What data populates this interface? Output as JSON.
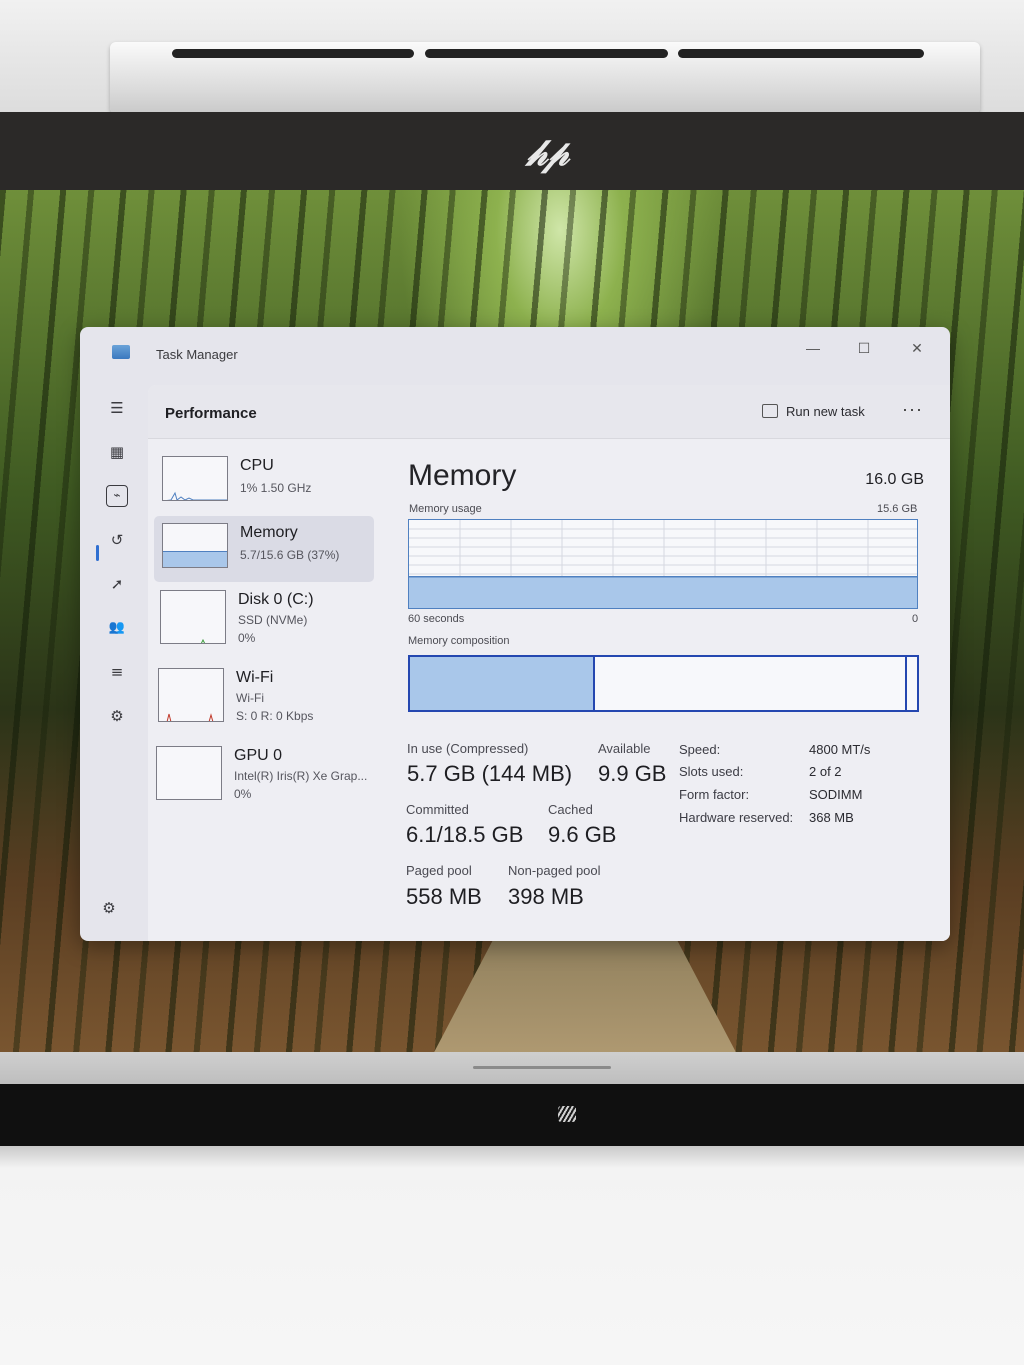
{
  "window": {
    "title": "Task Manager",
    "minimize_glyph": "—",
    "maximize_glyph": "☐",
    "close_glyph": "✕"
  },
  "nav": {
    "items": [
      {
        "name": "hamburger-menu-icon",
        "glyph": "☰"
      },
      {
        "name": "processes-icon",
        "glyph": "▦"
      },
      {
        "name": "performance-icon",
        "glyph": "⌁"
      },
      {
        "name": "app-history-icon",
        "glyph": "↺"
      },
      {
        "name": "startup-apps-icon",
        "glyph": "➚"
      },
      {
        "name": "users-icon",
        "glyph": "👥"
      },
      {
        "name": "details-icon",
        "glyph": "≡"
      },
      {
        "name": "services-icon",
        "glyph": "⚙"
      }
    ],
    "settings_glyph": "⚙"
  },
  "header": {
    "page_title": "Performance",
    "run_task_label": "Run new task",
    "more_glyph": "···"
  },
  "resources": [
    {
      "name": "CPU",
      "line1": "1%  1.50 GHz",
      "line2": ""
    },
    {
      "name": "Memory",
      "line1": "5.7/15.6 GB (37%)",
      "line2": ""
    },
    {
      "name": "Disk 0 (C:)",
      "line1": "SSD (NVMe)",
      "line2": "0%"
    },
    {
      "name": "Wi-Fi",
      "line1": "Wi-Fi",
      "line2": "S: 0  R: 0 Kbps"
    },
    {
      "name": "GPU 0",
      "line1": "Intel(R) Iris(R) Xe Grap...",
      "line2": "0%"
    }
  ],
  "detail": {
    "title": "Memory",
    "total": "16.0 GB",
    "usage_label": "Memory usage",
    "usage_max": "15.6 GB",
    "time_label": "60 seconds",
    "time_zero": "0",
    "composition_label": "Memory composition",
    "usage_fraction": 0.37,
    "composition": {
      "in_use_fraction": 0.365,
      "modified_fraction": 0.003,
      "standby_fraction": 0.612,
      "free_fraction": 0.02
    },
    "stats": {
      "in_use_label": "In use (Compressed)",
      "in_use_value": "5.7 GB (144 MB)",
      "available_label": "Available",
      "available_value": "9.9 GB",
      "committed_label": "Committed",
      "committed_value": "6.1/18.5 GB",
      "cached_label": "Cached",
      "cached_value": "9.6 GB",
      "paged_label": "Paged pool",
      "paged_value": "558 MB",
      "nonpaged_label": "Non-paged pool",
      "nonpaged_value": "398 MB"
    },
    "props": [
      {
        "label": "Speed:",
        "value": "4800 MT/s"
      },
      {
        "label": "Slots used:",
        "value": "2 of 2"
      },
      {
        "label": "Form factor:",
        "value": "SODIMM"
      },
      {
        "label": "Hardware reserved:",
        "value": "368 MB"
      }
    ]
  },
  "colors": {
    "memory_fill": "#a9c7ea",
    "memory_line": "#4f80c0",
    "composition_border": "#2447b0",
    "accent": "#2f6fd1"
  }
}
